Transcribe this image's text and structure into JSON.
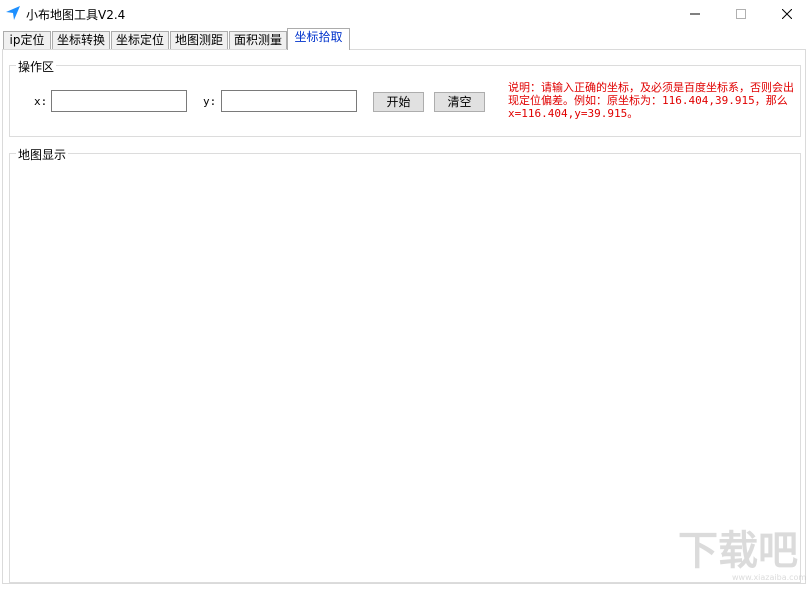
{
  "window": {
    "title": "小布地图工具V2.4",
    "minimize_icon": "minimize-icon",
    "maximize_icon": "maximize-icon",
    "close_icon": "close-icon",
    "app_icon": "navigation-arrow-icon",
    "accent": "#1e90ff"
  },
  "tabs": [
    {
      "label": "ip定位"
    },
    {
      "label": "坐标转换"
    },
    {
      "label": "坐标定位"
    },
    {
      "label": "地图测距"
    },
    {
      "label": "面积测量"
    },
    {
      "label": "坐标拾取",
      "active": true
    }
  ],
  "operation_area": {
    "legend": "操作区",
    "x_label": "x:",
    "y_label": "y:",
    "x_value": "",
    "y_value": "",
    "start_button": "开始",
    "clear_button": "清空",
    "note": "说明：请输入正确的坐标，及必须是百度坐标系，否则会出现定位偏差。例如：原坐标为：116.404,39.915，那么x=116.404,y=39.915。",
    "note_color": "#e00000"
  },
  "map_display": {
    "legend": "地图显示"
  },
  "watermark": {
    "text": "下载吧",
    "url_text": "www.xiazaiba.com"
  }
}
